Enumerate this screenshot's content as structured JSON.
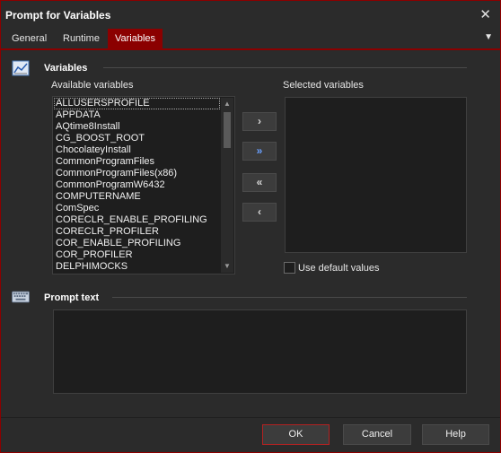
{
  "window": {
    "title": "Prompt for Variables",
    "close_glyph": "✕"
  },
  "tabs": [
    {
      "label": "General"
    },
    {
      "label": "Runtime"
    },
    {
      "label": "Variables",
      "active": true
    }
  ],
  "tab_menu_glyph": "▼",
  "variables_section": {
    "title": "Variables",
    "icon": "chart-icon",
    "available_label": "Available variables",
    "selected_label": "Selected variables",
    "available_items": [
      "ALLUSERSPROFILE",
      "APPDATA",
      "AQtime8Install",
      "CG_BOOST_ROOT",
      "ChocolateyInstall",
      "CommonProgramFiles",
      "CommonProgramFiles(x86)",
      "CommonProgramW6432",
      "COMPUTERNAME",
      "ComSpec",
      "CORECLR_ENABLE_PROFILING",
      "CORECLR_PROFILER",
      "COR_ENABLE_PROFILING",
      "COR_PROFILER",
      "DELPHIMOCKS"
    ],
    "selected_items": [],
    "buttons": {
      "add": "›",
      "add_all": "»",
      "remove_all": "«",
      "remove": "‹"
    },
    "use_default_label": "Use default values",
    "use_default_checked": false
  },
  "prompt_section": {
    "title": "Prompt text",
    "icon": "keyboard-icon",
    "value": ""
  },
  "footer": {
    "ok": "OK",
    "cancel": "Cancel",
    "help": "Help"
  },
  "colors": {
    "accent": "#8b0000",
    "background": "#2b2b2b",
    "input": "#1e1e1e"
  }
}
